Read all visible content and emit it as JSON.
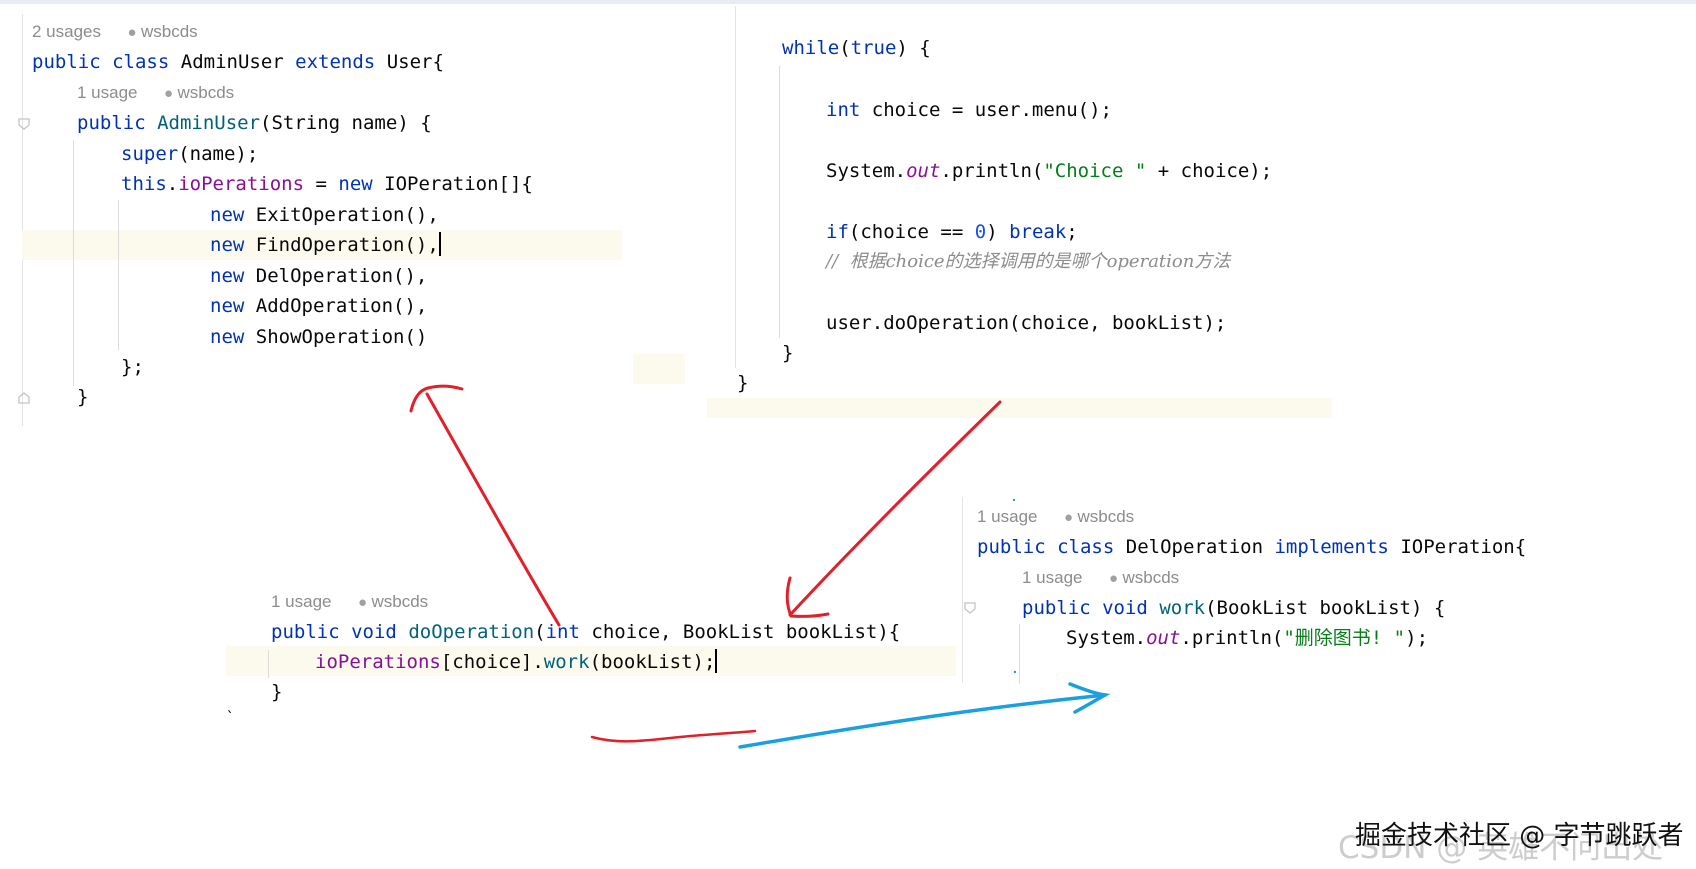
{
  "snippet_admin": {
    "class_hint_usages": "2 usages",
    "class_hint_author": "wsbcds",
    "class_decl": {
      "kw1": "public",
      "kw2": "class",
      "name": "AdminUser",
      "kw3": "extends",
      "parent": "User{"
    },
    "ctor_hint_usages": "1 usage",
    "ctor_hint_author": "wsbcds",
    "ctor_decl": {
      "kw": "public",
      "name": "AdminUser",
      "rest": "(String name) {"
    },
    "super_call": {
      "kw": "super",
      "rest": "(name);"
    },
    "assign": {
      "kw": "this",
      "dot": ".",
      "field": "ioPerations",
      "eq": " = ",
      "new_kw": "new",
      "type": " IOPeration[]{"
    },
    "items": [
      {
        "kw": "new",
        "name": " ExitOperation(),"
      },
      {
        "kw": "new",
        "name": " FindOperation(),"
      },
      {
        "kw": "new",
        "name": " DelOperation(),"
      },
      {
        "kw": "new",
        "name": " AddOperation(),"
      },
      {
        "kw": "new",
        "name": " ShowOperation()"
      }
    ],
    "close_array": "};",
    "close_ctor": "}"
  },
  "snippet_loop": {
    "while": {
      "kw": "while",
      "open": "(",
      "val": "true",
      "close": ") {"
    },
    "choice_line": {
      "kw": "int",
      "rest": " choice = user.menu();"
    },
    "print_line": {
      "pre": "System.",
      "out": "out",
      "mid": ".println(",
      "str": "\"Choice \"",
      "post": " + choice);"
    },
    "if_line": {
      "kw": "if",
      "mid": "(choice == ",
      "num": "0",
      "close": ") ",
      "brk": "break",
      "semi": ";"
    },
    "comment": "//  根据choice的选择调用的是哪个operation方法",
    "do_line": "user.doOperation(choice, bookList);",
    "close_inner": "}",
    "close_outer": "}"
  },
  "snippet_do": {
    "hint_usages": "1 usage",
    "hint_author": "wsbcds",
    "decl": {
      "kw1": "public",
      "kw2": "void",
      "name": "doOperation",
      "open": "(",
      "kw3": "int",
      "rest": " choice, BookList bookList){"
    },
    "body": {
      "field": "ioPerations",
      "mid": "[choice].",
      "fn": "work",
      "rest": "(bookList);"
    },
    "close": "}",
    "trail": "`"
  },
  "snippet_del": {
    "class_hint_usages": "1 usage",
    "class_hint_author": "wsbcds",
    "class_decl": {
      "kw1": "public",
      "kw2": "class",
      "name": "DelOperation",
      "kw3": "implements",
      "iface": "IOPeration{"
    },
    "method_hint_usages": "1 usage",
    "method_hint_author": "wsbcds",
    "method_decl": {
      "kw1": "public",
      "kw2": "void",
      "name": "work",
      "rest": "(BookList bookList) {"
    },
    "body": {
      "pre": "System.",
      "out": "out",
      "mid": ".println(",
      "str": "\"删除图书! \"",
      "post": ");"
    }
  },
  "watermark": {
    "text": "掘金技术社区 @ 字节跳跃者",
    "faint": "CSDN @ 英雄不问出处"
  },
  "colors": {
    "keyword": "#0033b3",
    "method": "#00627a",
    "field": "#871094",
    "string": "#067d17",
    "number": "#1750eb",
    "comment": "#8c8c8c",
    "annotation_red": "#e0202a",
    "annotation_blue": "#1a9fe0",
    "line_highlight": "#fcfaed"
  },
  "icons": {
    "author": "person-icon",
    "fold": "fold-marker-icon"
  }
}
